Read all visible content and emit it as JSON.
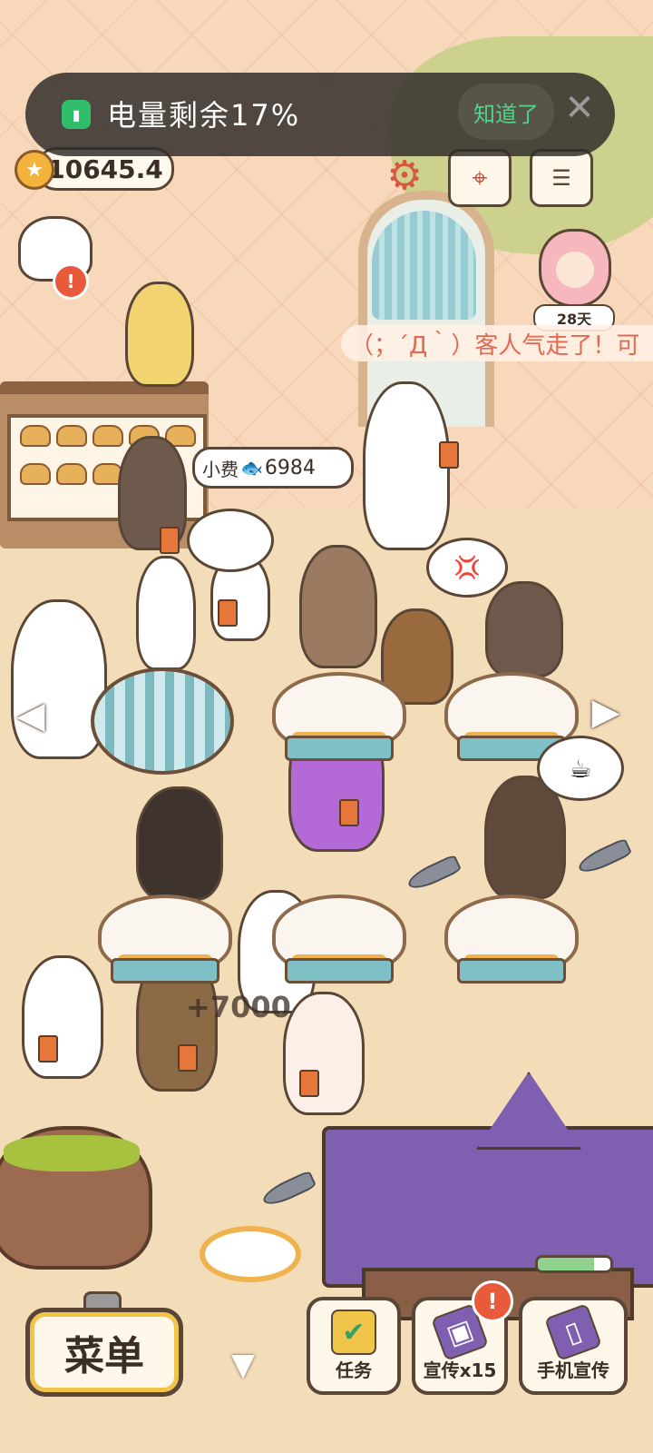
{
  "status_banner": {
    "text": "电量剩余17%",
    "confirm_label": "知道了",
    "close_icon": "close-icon",
    "battery_icon": "battery-icon"
  },
  "currency": {
    "fish_value": "10645.4",
    "icon": "star-coin-icon"
  },
  "top_icons": [
    "settings-gear-icon",
    "map-icon",
    "sort-icon"
  ],
  "days_badge": "28天",
  "ticker": "（；´Д｀）客人气走了！可",
  "tip_bubble": {
    "label": "小费",
    "value": "6984",
    "icon": "fish-icon"
  },
  "floating_income": "+7000",
  "bottom_bar": {
    "menu_label": "菜单",
    "tasks_label": "任务",
    "promo_label": "宣传x15",
    "phone_promo_label": "手机宣传",
    "alert_mark": "!",
    "phone_promo_progress": 0.78
  },
  "colors": {
    "accent_gold": "#f1c44a",
    "alert_red": "#e95a3a",
    "confirm_green": "#4fd48a"
  }
}
